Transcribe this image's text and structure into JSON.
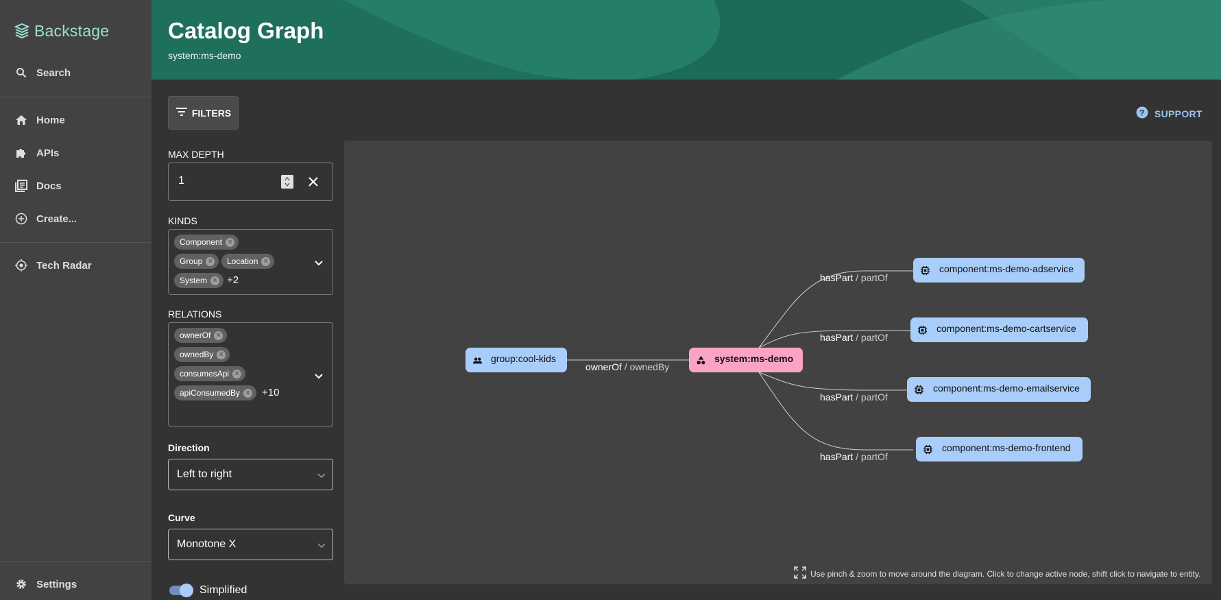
{
  "app": {
    "name": "Backstage"
  },
  "sidebar": {
    "search_label": "Search",
    "items": [
      {
        "label": "Home",
        "icon": "home-icon"
      },
      {
        "label": "APIs",
        "icon": "puzzle-icon"
      },
      {
        "label": "Docs",
        "icon": "library-icon"
      },
      {
        "label": "Create...",
        "icon": "add-circle-icon"
      },
      {
        "label": "Tech Radar",
        "icon": "radar-icon"
      }
    ],
    "settings_label": "Settings"
  },
  "header": {
    "title": "Catalog Graph",
    "subtitle": "system:ms-demo"
  },
  "toolbar": {
    "filters_label": "FILTERS",
    "support_label": "SUPPORT"
  },
  "filters": {
    "max_depth": {
      "label": "MAX DEPTH",
      "value": "1"
    },
    "kinds": {
      "label": "KINDS",
      "chips": [
        "Component",
        "Group",
        "Location",
        "System"
      ],
      "more": "+2"
    },
    "relations": {
      "label": "RELATIONS",
      "chips": [
        "ownerOf",
        "ownedBy",
        "consumesApi",
        "apiConsumedBy"
      ],
      "more": "+10"
    },
    "direction": {
      "label": "Direction",
      "value": "Left to right"
    },
    "curve": {
      "label": "Curve",
      "value": "Monotone X"
    },
    "simplified": {
      "label": "Simplified",
      "checked": true
    }
  },
  "graph": {
    "nodes": {
      "group": "group:cool-kids",
      "system": "system:ms-demo",
      "adservice": "component:ms-demo-adservice",
      "cartservice": "component:ms-demo-cartservice",
      "emailservice": "component:ms-demo-emailservice",
      "frontend": "component:ms-demo-frontend"
    },
    "edges": {
      "owner": {
        "main": "ownerOf",
        "sep": " / ",
        "sub": "ownedBy"
      },
      "part": {
        "main": "hasPart",
        "sep": " / ",
        "sub": "partOf"
      }
    },
    "hint": "Use pinch & zoom to move around the diagram. Click to change active node, shift click to navigate to entity."
  },
  "colors": {
    "header_bg": "#1e6f5c",
    "component_node": "#a9cdfa",
    "system_node": "#fba3c6",
    "accent_link": "#9cc3f5"
  }
}
